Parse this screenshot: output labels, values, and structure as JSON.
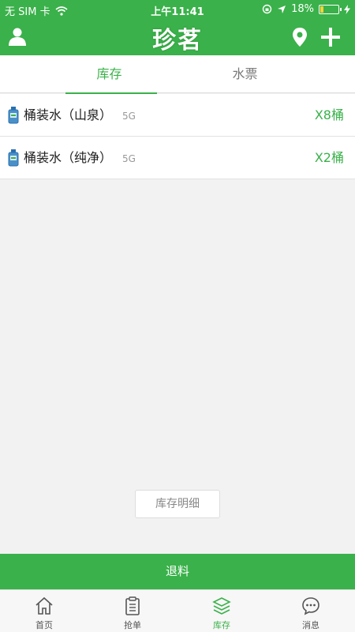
{
  "status_bar": {
    "carrier": "无 SIM 卡",
    "time": "上午11:41",
    "battery": "18%",
    "battery_level": 0.18
  },
  "header": {
    "logo_text": "珍茗",
    "icons": [
      "user-icon",
      "location-icon",
      "plus-icon"
    ]
  },
  "tabs": [
    {
      "label": "库存",
      "active": true
    },
    {
      "label": "水票",
      "active": false
    }
  ],
  "items": [
    {
      "name": "桶装水（山泉）",
      "spec": "5G",
      "qty": "X8桶"
    },
    {
      "name": "桶装水（纯净）",
      "spec": "5G",
      "qty": "X2桶"
    }
  ],
  "detail_button": "库存明细",
  "return_button": "退料",
  "bottom_nav": [
    {
      "label": "首页",
      "icon": "home-icon",
      "active": false
    },
    {
      "label": "抢单",
      "icon": "clipboard-icon",
      "active": false
    },
    {
      "label": "库存",
      "icon": "layers-icon",
      "active": true
    },
    {
      "label": "消息",
      "icon": "chat-icon",
      "active": false
    }
  ],
  "colors": {
    "accent": "#3ab14a",
    "background": "#f2f2f2"
  }
}
